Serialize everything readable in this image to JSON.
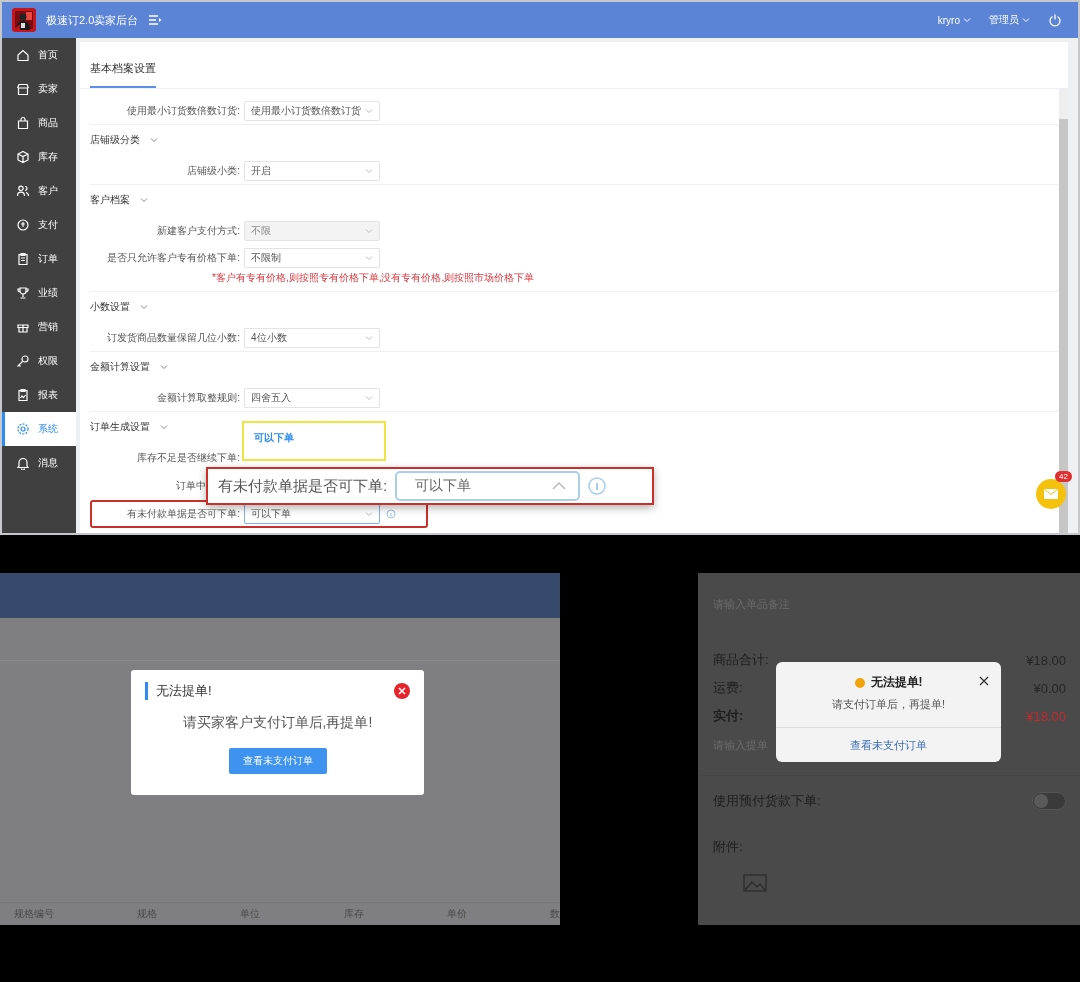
{
  "admin": {
    "app_title": "极速订2.0卖家后台",
    "user_menus": [
      "kryro",
      "管理员"
    ],
    "sidebar": {
      "items": [
        {
          "label": "首页",
          "selected": false
        },
        {
          "label": "卖家",
          "selected": false
        },
        {
          "label": "商品",
          "selected": false
        },
        {
          "label": "库存",
          "selected": false
        },
        {
          "label": "客户",
          "selected": false
        },
        {
          "label": "支付",
          "selected": false
        },
        {
          "label": "订单",
          "selected": false
        },
        {
          "label": "业绩",
          "selected": false
        },
        {
          "label": "营销",
          "selected": false
        },
        {
          "label": "权限",
          "selected": false
        },
        {
          "label": "报表",
          "selected": false
        },
        {
          "label": "系统",
          "selected": true
        },
        {
          "label": "消息",
          "selected": false
        }
      ]
    },
    "tabs": [
      {
        "label": "基本档案设置",
        "selected": true
      }
    ],
    "sections": [
      {
        "rows": [
          {
            "kind": "select",
            "label": "使用最小订货数倍数订货:",
            "value": "使用最小订货数倍数订货",
            "disabled": false,
            "highlighted": false
          }
        ]
      },
      {
        "title": "店铺级分类",
        "rows": [
          {
            "kind": "select",
            "label": "店铺级小类:",
            "value": "开启",
            "disabled": false,
            "highlighted": false
          }
        ]
      },
      {
        "title": "客户档案",
        "rows": [
          {
            "kind": "select",
            "label": "新建客户支付方式:",
            "value": "不限",
            "disabled": true,
            "highlighted": false
          },
          {
            "kind": "select",
            "label": "是否只允许客户专有价格下单:",
            "value": "不限制",
            "disabled": false,
            "highlighted": false
          }
        ],
        "note": "*客户有专有价格,则按照专有价格下单,没有专有价格,则按照市场价格下单"
      },
      {
        "title": "小数设置",
        "rows": [
          {
            "kind": "select",
            "label": "订发货商品数量保留几位小数:",
            "value": "4位小数",
            "disabled": false,
            "highlighted": false
          }
        ]
      },
      {
        "title": "金额计算设置",
        "rows": [
          {
            "kind": "select",
            "label": "金额计算取整规则:",
            "value": "四舍五入",
            "disabled": false,
            "highlighted": false
          }
        ]
      },
      {
        "title": "订单生成设置",
        "rows": [
          {
            "kind": "label",
            "label": "库存不足是否继续下单:",
            "highlighted": false
          },
          {
            "kind": "partial_label",
            "label": "订单中",
            "highlighted": false
          },
          {
            "kind": "select_info",
            "label": "有未付款单据是否可下单:",
            "value": "可以下单",
            "disabled": false,
            "highlighted": true
          }
        ]
      }
    ],
    "dropdown": {
      "options": [
        {
          "label": "可以下单",
          "selected": true
        }
      ]
    },
    "callout": {
      "label": "有未付款单据是否可下单:",
      "value": "可以下单"
    },
    "mail": {
      "badge": "42"
    }
  },
  "web_dialog": {
    "columns": [
      "规格编号",
      "规格",
      "单位",
      "库存",
      "单价",
      "数"
    ],
    "dialog": {
      "title": "无法提单!",
      "message": "请买家客户支付订单后,再提单!",
      "button": "查看未支付订单"
    }
  },
  "mobile_dialog": {
    "remark_placeholder": "请输入单品备注",
    "summary": [
      {
        "kind": "plain",
        "label": "商品合计:",
        "value": "¥18.00"
      },
      {
        "kind": "plain",
        "label": "运费:",
        "value": "¥0.00"
      },
      {
        "kind": "total",
        "label": "实付:",
        "value": "¥18.00"
      }
    ],
    "order_remark_placeholder": "请输入提单",
    "prepay": {
      "label": "使用预付货款下单:",
      "on": false
    },
    "attachment_label": "附件:",
    "dialog": {
      "title": "无法提单!",
      "message": "请支付订单后，再提单!",
      "link": "查看未支付订单"
    }
  }
}
